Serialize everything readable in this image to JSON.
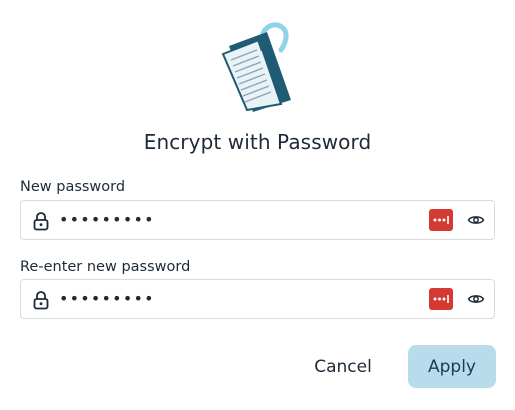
{
  "dialog": {
    "title": "Encrypt with Password",
    "illustration": "encrypted-document-padlock-illustration"
  },
  "fields": [
    {
      "label": "New password",
      "value": "•••••••••",
      "leading_icon": "lock-icon",
      "trailing_icons": [
        "password-manager-icon",
        "eye-icon"
      ]
    },
    {
      "label": "Re-enter new password",
      "value": "•••••••••",
      "leading_icon": "lock-icon",
      "trailing_icons": [
        "password-manager-icon",
        "eye-icon"
      ]
    }
  ],
  "buttons": {
    "cancel_label": "Cancel",
    "apply_label": "Apply"
  },
  "colors": {
    "accent_button": "#b8dcec",
    "password_manager_badge": "#d43a31",
    "illustration_dark": "#1f5c73",
    "illustration_light": "#8fd3e8"
  }
}
